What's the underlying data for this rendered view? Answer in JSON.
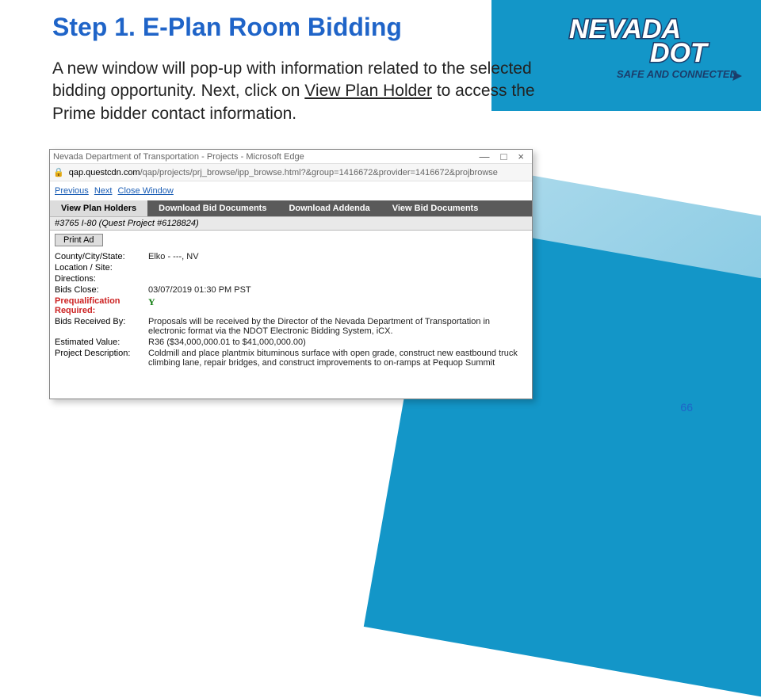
{
  "slide": {
    "title": "Step 1. E-Plan Room Bidding",
    "body_prefix": "A new window will pop-up with information related to the selected bidding opportunity. Next, click on ",
    "body_link": "View Plan Holder",
    "body_suffix": " to access the Prime bidder contact information.",
    "page_number": "66"
  },
  "logo": {
    "line1": "NEVADA",
    "line2": "DOT",
    "tagline": "SAFE AND CONNECTED"
  },
  "window": {
    "title": "Nevada Department of Transportation - Projects - Microsoft Edge",
    "min": "—",
    "max": "□",
    "close": "×",
    "url_domain": "qap.questcdn.com",
    "url_path": "/qap/projects/prj_browse/ipp_browse.html?&group=1416672&provider=1416672&projbrowse",
    "nav": {
      "prev": "Previous",
      "next": "Next",
      "close": "Close Window"
    },
    "menu": {
      "view_plan_holders": "View Plan Holders",
      "download_bid_docs": "Download Bid Documents",
      "download_addenda": "Download Addenda",
      "view_bid_docs": "View Bid Documents"
    },
    "project_title": "#3765 I-80 (Quest Project #6128824)",
    "print_ad": "Print Ad",
    "fields": {
      "county_label": "County/City/State:",
      "county_value": "Elko - ---, NV",
      "location_label": "Location / Site:",
      "location_value": "",
      "directions_label": "Directions:",
      "directions_value": "",
      "bids_close_label": "Bids Close:",
      "bids_close_value": "03/07/2019 01:30 PM PST",
      "prequal_label": "Prequalification Required:",
      "prequal_value": "Y",
      "received_label": "Bids Received By:",
      "received_value": "Proposals will be received by the Director of the Nevada Department of Transportation in electronic format via the NDOT Electronic Bidding System, iCX.",
      "estvalue_label": "Estimated Value:",
      "estvalue_value": "R36 ($34,000,000.01 to $41,000,000.00)",
      "desc_label": "Project Description:",
      "desc_value": "Coldmill and place plantmix bituminous surface with open grade, construct new eastbound truck climbing lane, repair bridges, and construct improvements to on-ramps at Pequop Summit"
    }
  }
}
